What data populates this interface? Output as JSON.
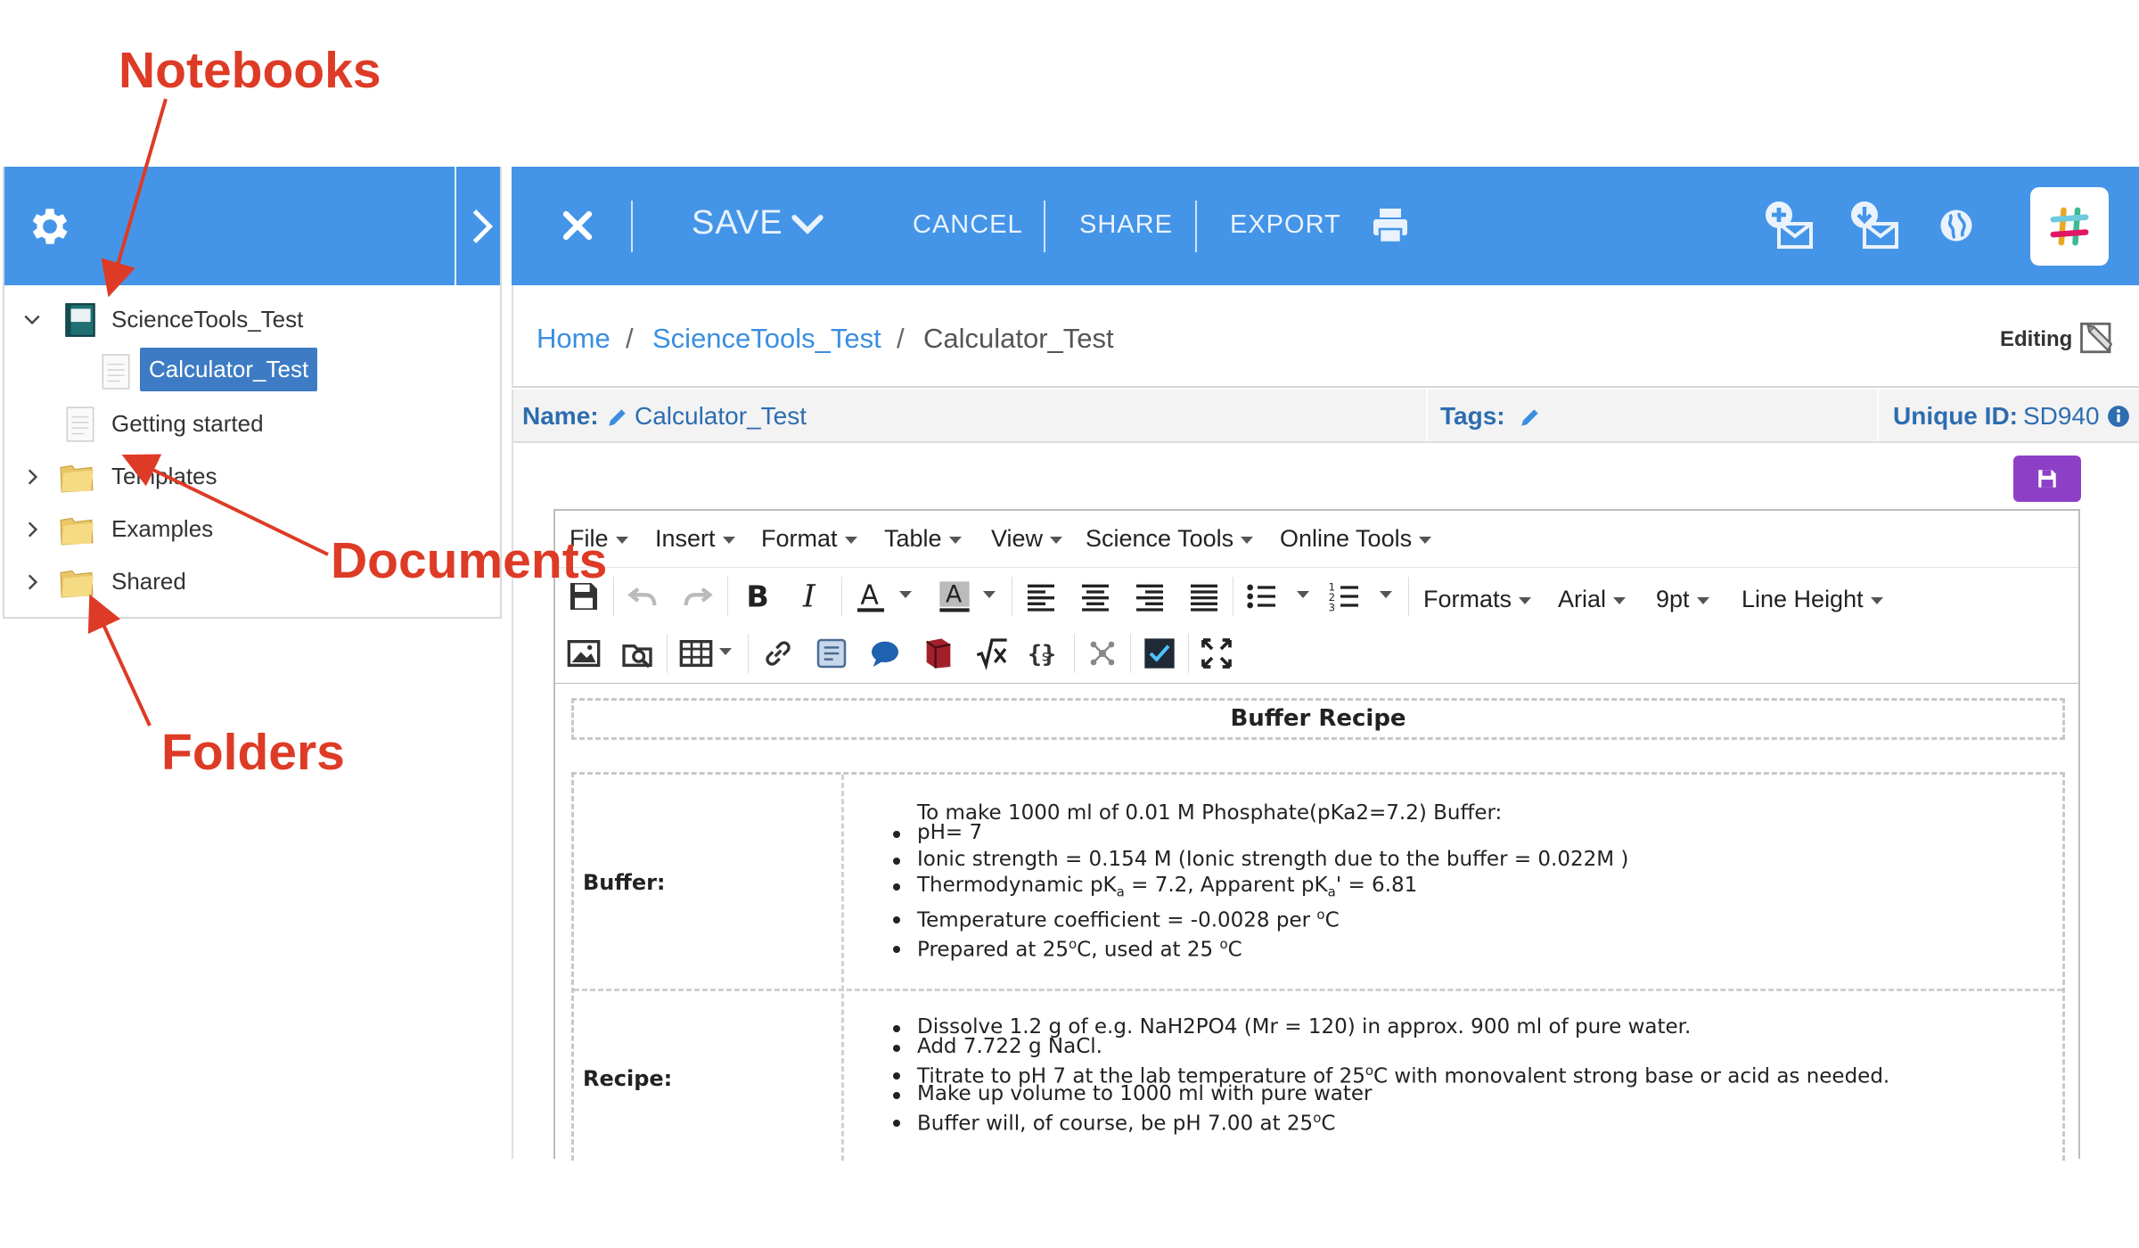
{
  "annotations": {
    "notebooks": "Notebooks",
    "documents": "Documents",
    "folders": "Folders"
  },
  "sidebar": {
    "items": [
      {
        "label": "ScienceTools_Test",
        "icon": "notebook-icon",
        "expanded": true
      },
      {
        "label": "Calculator_Test",
        "icon": "document-icon",
        "selected": true
      },
      {
        "label": "Getting started",
        "icon": "document-icon"
      },
      {
        "label": "Templates",
        "icon": "folder-icon"
      },
      {
        "label": "Examples",
        "icon": "folder-icon"
      },
      {
        "label": "Shared",
        "icon": "folder-icon"
      }
    ]
  },
  "topbar": {
    "save_label": "SAVE",
    "cancel_label": "CANCEL",
    "share_label": "SHARE",
    "export_label": "EXPORT",
    "accent_color": "#4495e8"
  },
  "breadcrumb": {
    "home": "Home",
    "separator": "/",
    "notebook": "ScienceTools_Test",
    "current": "Calculator_Test",
    "mode_label": "Editing"
  },
  "meta": {
    "name_label": "Name:",
    "name_value": "Calculator_Test",
    "tags_label": "Tags:",
    "unique_id_label": "Unique ID:",
    "unique_id_value": "SD940"
  },
  "editor": {
    "menus": [
      "File",
      "Insert",
      "Format",
      "Table",
      "View",
      "Science Tools",
      "Online Tools"
    ],
    "formats_label": "Formats",
    "font_label": "Arial",
    "size_label": "9pt",
    "line_height_label": "Line Height"
  },
  "document": {
    "title": "Buffer Recipe",
    "buffer": {
      "label": "Buffer:",
      "intro": "To make 1000 ml of 0.01 M Phosphate(pKa2=7.2) Buffer:",
      "bullets": [
        "pH= 7",
        "Ionic strength = 0.154 M (Ionic strength due to the buffer = 0.022M )",
        "Thermodynamic pK",
        "a",
        " = 7.2, Apparent pK",
        "a",
        "' = 6.81",
        "Temperature coefficient = -0.0028 per ",
        "o",
        "C",
        "Prepared at 25",
        "o",
        "C, used at 25 ",
        "o",
        "C"
      ]
    },
    "recipe": {
      "label": "Recipe:",
      "bullets": [
        "Dissolve 1.2 g of e.g. NaH2PO4 (Mr = 120) in approx. 900 ml of pure water.",
        "Add 7.722 g NaCl.",
        "Titrate to pH 7 at the lab temperature of 25",
        "o",
        "C with monovalent strong base or acid as needed.",
        "Make up volume to 1000 ml with pure water",
        "Buffer will, of course, be pH 7.00 at 25",
        "o",
        "C"
      ]
    }
  }
}
